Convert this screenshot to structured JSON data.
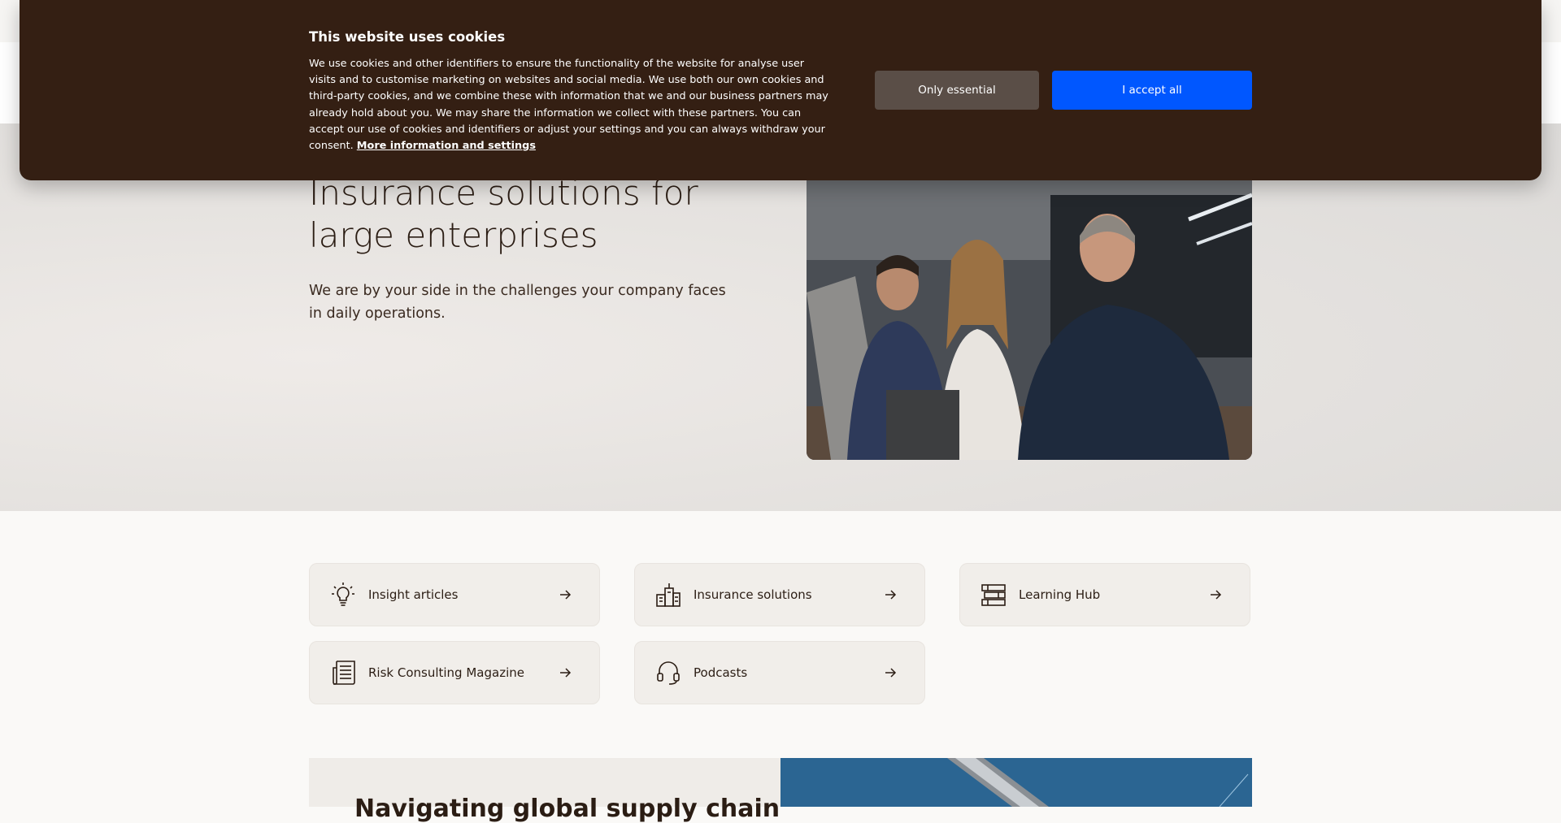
{
  "hero": {
    "title": "Insurance solutions for large enterprises",
    "subtitle": "We are by your side in the challenges your company faces in daily operations."
  },
  "quick_links": [
    {
      "label": "Insight articles",
      "icon": "lightbulb-icon"
    },
    {
      "label": "Insurance solutions",
      "icon": "buildings-icon"
    },
    {
      "label": "Learning Hub",
      "icon": "stacked-books-icon"
    },
    {
      "label": "Risk Consulting Magazine",
      "icon": "newspaper-icon"
    },
    {
      "label": "Podcasts",
      "icon": "headset-icon"
    }
  ],
  "teaser": {
    "title": "Navigating global supply chain"
  },
  "cookie_banner": {
    "title": "This website uses cookies",
    "text": "We use cookies and other identifiers to ensure the functionality of the website for analyse user visits and to customise marketing on websites and social media. We use both our own cookies and third-party cookies, and we combine these with information that we and our business partners may already hold about you. We may share the information we collect with these partners. You can accept our use of cookies and identifiers or adjust your settings and you can always withdraw your consent.",
    "link_label": "More information and settings",
    "essential_button": "Only essential",
    "accept_button": "I accept all"
  },
  "colors": {
    "banner_bg": "#341f13",
    "accept_button": "#0057ff",
    "essential_button": "#5a4e47",
    "card_bg": "#f1eeea"
  }
}
